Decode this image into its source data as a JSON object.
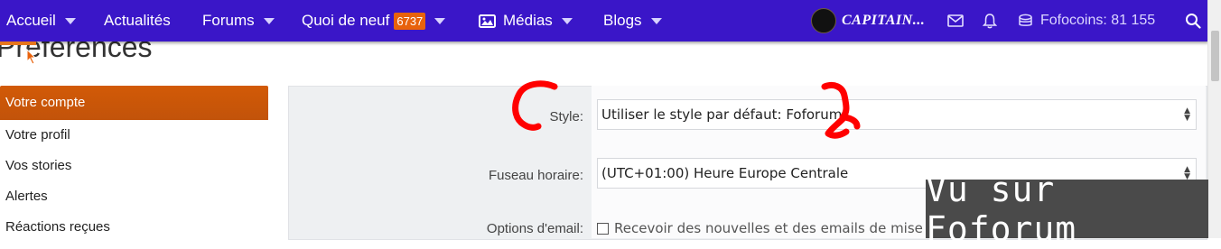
{
  "nav": {
    "items": [
      {
        "label": "Accueil"
      },
      {
        "label": "Actualités"
      },
      {
        "label": "Forums"
      },
      {
        "label": "Quoi de neuf",
        "badge": "6737"
      },
      {
        "label": "Médias"
      },
      {
        "label": "Blogs"
      }
    ],
    "username": "CAPITAIN...",
    "coins": "Fofocoins: 81 155"
  },
  "page": {
    "title": "Préférences"
  },
  "sidebar": {
    "items": [
      {
        "label": "Votre compte",
        "active": true
      },
      {
        "label": "Votre profil"
      },
      {
        "label": "Vos stories"
      },
      {
        "label": "Alertes"
      },
      {
        "label": "Réactions reçues"
      }
    ]
  },
  "form": {
    "style_label": "Style:",
    "style_value": "Utiliser le style par défaut: Foforum",
    "timezone_label": "Fuseau horaire:",
    "timezone_value": "(UTC+01:00) Heure Europe Centrale",
    "email_label": "Options d'email:",
    "email_option": "Recevoir des nouvelles et des emails de mise à jour"
  },
  "watermark": "Vu sur Foforum",
  "colors": {
    "navbar": "#3a16c8",
    "accent": "#d25a07",
    "badge": "#e8620c",
    "annotation": "#ff0000"
  }
}
